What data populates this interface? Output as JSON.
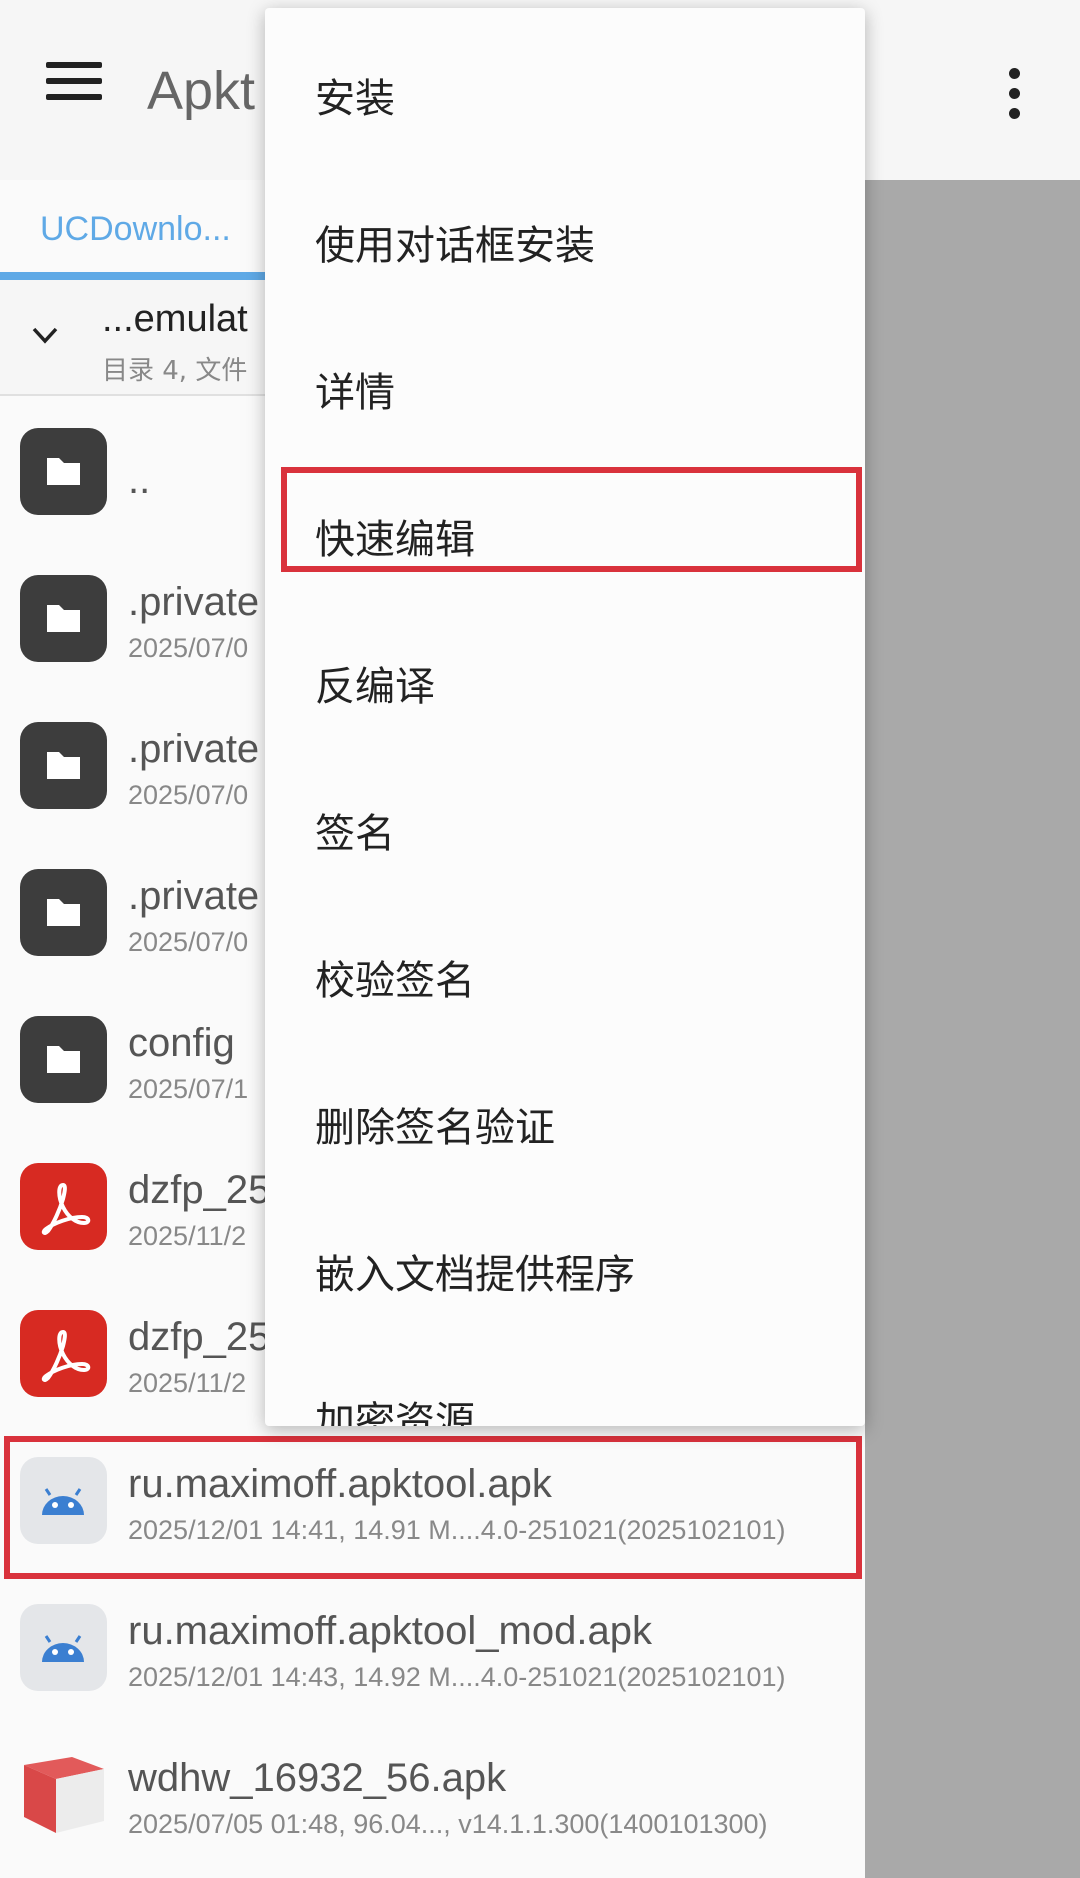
{
  "appbar": {
    "title": "Apkt"
  },
  "tab": {
    "label": "UCDownlo..."
  },
  "path": {
    "name": "...emulat",
    "summary": "目录 4, 文件"
  },
  "files": [
    {
      "name": "..",
      "meta": "",
      "icon": "folder-icon"
    },
    {
      "name": ".private",
      "meta": "2025/07/0",
      "icon": "folder-icon"
    },
    {
      "name": ".private",
      "meta": "2025/07/0",
      "icon": "folder-icon"
    },
    {
      "name": ".private",
      "meta": "2025/07/0",
      "icon": "folder-icon"
    },
    {
      "name": "config",
      "meta": "2025/07/1",
      "icon": "folder-icon"
    },
    {
      "name": "dzfp_25",
      "meta": "2025/11/2",
      "icon": "pdf-icon"
    },
    {
      "name": "dzfp_25",
      "meta": "2025/11/2",
      "icon": "pdf-icon"
    },
    {
      "name": "ru.maximoff.apktool.apk",
      "meta": "2025/12/01 14:41, 14.91 M....4.0-251021(2025102101)",
      "icon": "android-apk-icon"
    },
    {
      "name": "ru.maximoff.apktool_mod.apk",
      "meta": "2025/12/01 14:43, 14.92 M....4.0-251021(2025102101)",
      "icon": "android-apk-icon"
    },
    {
      "name": "wdhw_16932_56.apk",
      "meta": "2025/07/05 01:48, 96.04..., v14.1.1.300(1400101300)",
      "icon": "huawei-box-icon"
    }
  ],
  "context_menu": {
    "items": [
      "安装",
      "使用对话框安装",
      "详情",
      "快速编辑",
      "反编译",
      "签名",
      "校验签名",
      "删除签名验证",
      "嵌入文档提供程序",
      "加密资源"
    ]
  },
  "colors": {
    "accent": "#5fa9e6",
    "highlight": "#d9323c",
    "folder": "#3d3d3d",
    "pdf": "#d72a22"
  }
}
